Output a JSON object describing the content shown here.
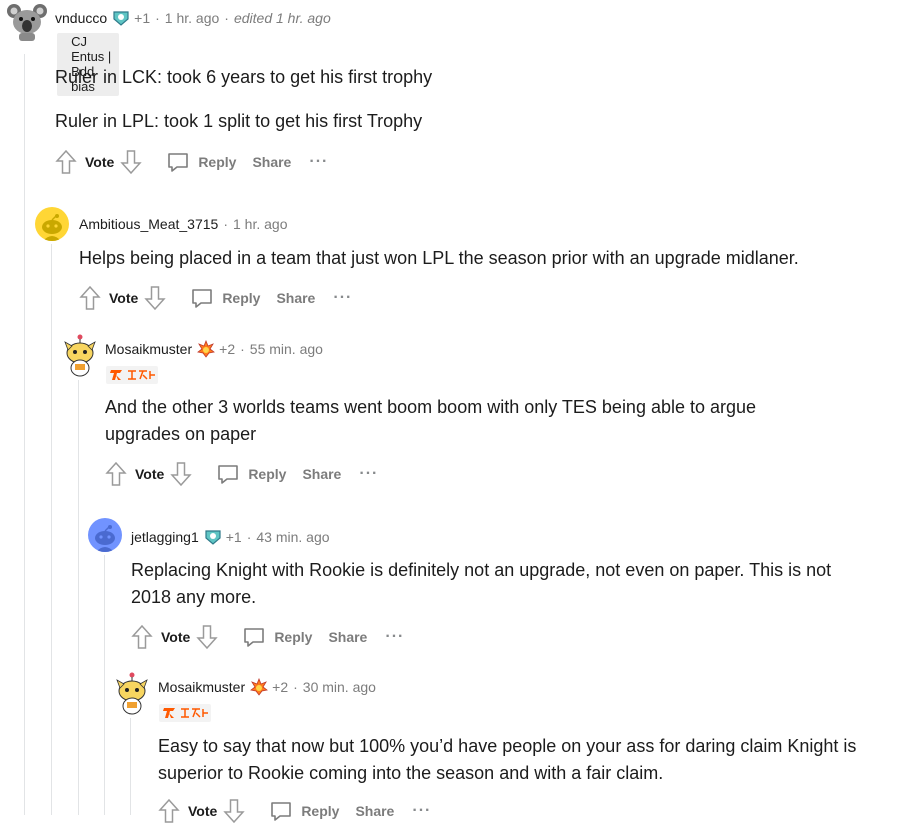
{
  "comments": [
    {
      "username": "vnducco",
      "award_count": "+1",
      "time": "1 hr. ago",
      "edited": "edited 1 hr. ago",
      "flair": "CJ Entus | Bdd bias",
      "paragraphs": [
        "Ruler in LCK: took 6 years to get his first trophy",
        "Ruler in LPL: took 1 split to get his first Trophy"
      ],
      "avatar_icon": "koala-avatar-icon"
    },
    {
      "username": "Ambitious_Meat_3715",
      "time": "1 hr. ago",
      "paragraphs": [
        "Helps being placed in a team that just won LPL the season prior with an upgrade midlaner."
      ],
      "avatar_icon": "default-snoo-avatar-icon"
    },
    {
      "username": "Mosaikmuster",
      "award_count": "+2",
      "time": "55 min. ago",
      "paragraphs": [
        "And the other 3 worlds teams went boom boom with only TES being able to argue upgrades on paper"
      ],
      "avatar_icon": "snoo-avatar-icon"
    },
    {
      "username": "jetlagging1",
      "award_count": "+1",
      "time": "43 min. ago",
      "paragraphs": [
        "Replacing Knight with Rookie is definitely not an upgrade, not even on paper. This is not 2018 any more."
      ],
      "avatar_icon": "default-snoo-avatar-icon"
    },
    {
      "username": "Mosaikmuster",
      "award_count": "+2",
      "time": "30 min. ago",
      "paragraphs": [
        "Easy to say that now but 100% you’d have people on your ass for daring claim Knight is superior to Rookie coming into the season and with a fair claim."
      ],
      "avatar_icon": "snoo-avatar-icon"
    }
  ],
  "actions": {
    "vote": "Vote",
    "reply": "Reply",
    "share": "Share",
    "more": "···"
  },
  "colors": {
    "text": "#1c1c1c",
    "meta": "#7c7c7c",
    "thread_line": "#e2e4e6",
    "fnatic_orange": "#ff5900"
  }
}
